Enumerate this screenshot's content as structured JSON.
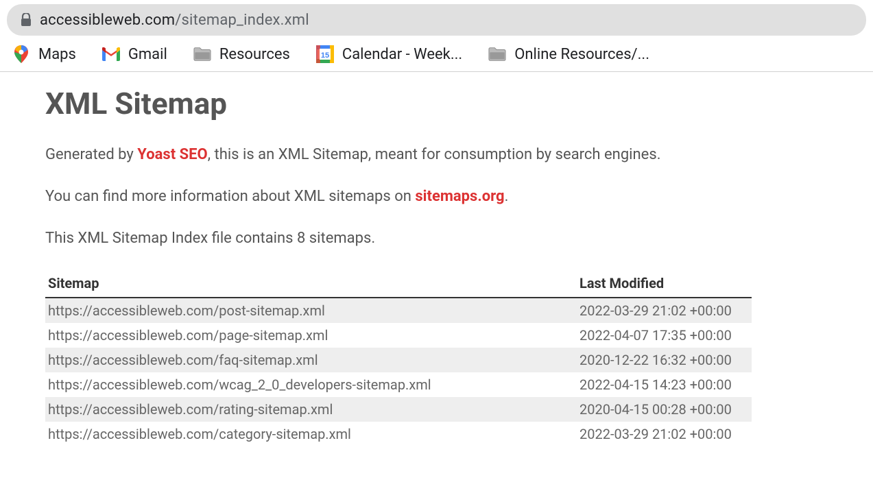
{
  "address_bar": {
    "domain": "accessibleweb.com",
    "path": "/sitemap_index.xml"
  },
  "bookmarks": [
    {
      "label": "Maps",
      "icon": "maps"
    },
    {
      "label": "Gmail",
      "icon": "gmail"
    },
    {
      "label": "Resources",
      "icon": "folder"
    },
    {
      "label": "Calendar - Week...",
      "icon": "calendar"
    },
    {
      "label": "Online Resources/...",
      "icon": "folder"
    }
  ],
  "page": {
    "title": "XML Sitemap",
    "intro1_pre": "Generated by ",
    "intro1_link": "Yoast SEO",
    "intro1_post": ", this is an XML Sitemap, meant for consumption by search engines.",
    "intro2_pre": "You can find more information about XML sitemaps on ",
    "intro2_link": "sitemaps.org",
    "intro2_post": ".",
    "count_line": "This XML Sitemap Index file contains 8 sitemaps.",
    "table": {
      "col1": "Sitemap",
      "col2": "Last Modified",
      "rows": [
        {
          "url": "https://accessibleweb.com/post-sitemap.xml",
          "modified": "2022-03-29 21:02 +00:00"
        },
        {
          "url": "https://accessibleweb.com/page-sitemap.xml",
          "modified": "2022-04-07 17:35 +00:00"
        },
        {
          "url": "https://accessibleweb.com/faq-sitemap.xml",
          "modified": "2020-12-22 16:32 +00:00"
        },
        {
          "url": "https://accessibleweb.com/wcag_2_0_developers-sitemap.xml",
          "modified": "2022-04-15 14:23 +00:00"
        },
        {
          "url": "https://accessibleweb.com/rating-sitemap.xml",
          "modified": "2020-04-15 00:28 +00:00"
        },
        {
          "url": "https://accessibleweb.com/category-sitemap.xml",
          "modified": "2022-03-29 21:02 +00:00"
        }
      ]
    }
  }
}
